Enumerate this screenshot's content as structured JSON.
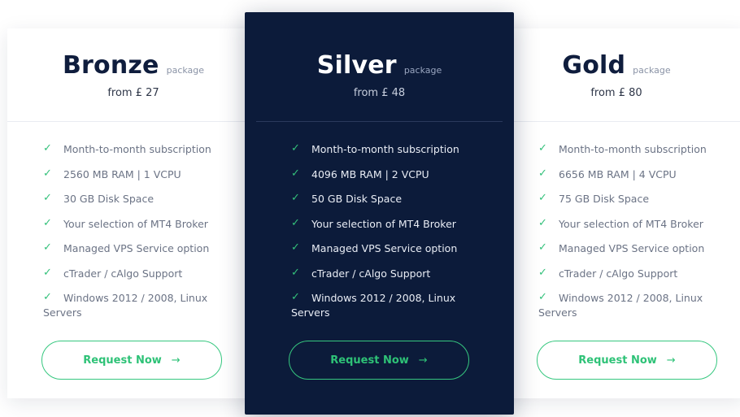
{
  "plans": [
    {
      "name": "Bronze",
      "tag": "package",
      "price": "from £ 27",
      "features": [
        "Month-to-month subscription",
        "2560 MB RAM | 1 VCPU",
        "30 GB Disk Space",
        "Your selection of MT4 Broker",
        "Managed VPS Service option",
        "cTrader / cAlgo Support",
        "Windows 2012 / 2008, Linux Servers"
      ],
      "button": "Request Now",
      "button_icon": "arrow-right-icon"
    },
    {
      "name": "Silver",
      "tag": "package",
      "price": "from £ 48",
      "features": [
        "Month-to-month subscription",
        "4096 MB RAM | 2 VCPU",
        "50 GB Disk Space",
        "Your selection of MT4 Broker",
        "Managed VPS Service option",
        "cTrader / cAlgo Support",
        "Windows 2012 / 2008, Linux Servers"
      ],
      "button": "Request Now",
      "button_icon": "arrow-right-icon"
    },
    {
      "name": "Gold",
      "tag": "package",
      "price": "from £ 80",
      "features": [
        "Month-to-month subscription",
        "6656 MB RAM | 4 VCPU",
        "75 GB Disk Space",
        "Your selection of MT4 Broker",
        "Managed VPS Service option",
        "cTrader / cAlgo Support",
        "Windows 2012 / 2008, Linux Servers"
      ],
      "button": "Request Now",
      "button_icon": "arrow-right-icon"
    }
  ],
  "colors": {
    "highlight_card": "#0c1b3a",
    "accent_green": "#34c17b",
    "title_dark": "#0f1d3d"
  },
  "check_icon": "check-icon"
}
